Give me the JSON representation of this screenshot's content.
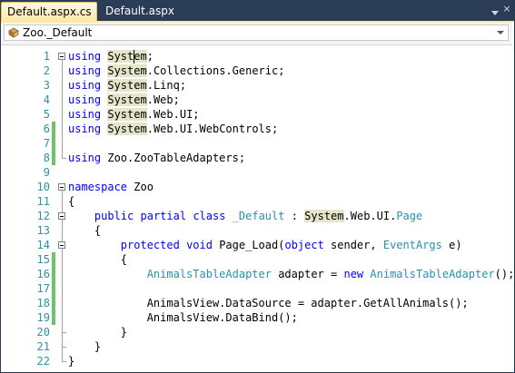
{
  "tabs": [
    {
      "label": "Default.aspx.cs",
      "active": true
    },
    {
      "label": "Default.aspx",
      "active": false
    }
  ],
  "navigation": {
    "type_dropdown": "Zoo._Default",
    "icon": "class-icon"
  },
  "close_glyph": "×",
  "colors": {
    "keyword": "#0000ff",
    "type": "#2b91af",
    "line_number": "#2b91af",
    "change_saved": "#6dc46d",
    "highlight": "#e5e5c9",
    "frame": "#293955",
    "active_tab": "#ffe8a6"
  },
  "lines": [
    {
      "n": "1",
      "change": "none",
      "tokens": [
        {
          "t": "using",
          "c": "kw"
        },
        {
          "t": " "
        },
        {
          "t": "System",
          "c": "hl"
        },
        {
          "t": ";"
        }
      ]
    },
    {
      "n": "2",
      "change": "none",
      "tokens": [
        {
          "t": "using",
          "c": "kw"
        },
        {
          "t": " "
        },
        {
          "t": "System",
          "c": "hl"
        },
        {
          "t": ".Collections.Generic;"
        }
      ]
    },
    {
      "n": "3",
      "change": "none",
      "tokens": [
        {
          "t": "using",
          "c": "kw"
        },
        {
          "t": " "
        },
        {
          "t": "System",
          "c": "hl"
        },
        {
          "t": ".Linq;"
        }
      ]
    },
    {
      "n": "4",
      "change": "none",
      "tokens": [
        {
          "t": "using",
          "c": "kw"
        },
        {
          "t": " "
        },
        {
          "t": "System",
          "c": "hl"
        },
        {
          "t": ".Web;"
        }
      ]
    },
    {
      "n": "5",
      "change": "none",
      "tokens": [
        {
          "t": "using",
          "c": "kw"
        },
        {
          "t": " "
        },
        {
          "t": "System",
          "c": "hl"
        },
        {
          "t": ".Web.UI;"
        }
      ]
    },
    {
      "n": "6",
      "change": "green",
      "tokens": [
        {
          "t": "using",
          "c": "kw"
        },
        {
          "t": " "
        },
        {
          "t": "System",
          "c": "hl"
        },
        {
          "t": ".Web.UI.WebControls;"
        }
      ]
    },
    {
      "n": "7",
      "change": "green",
      "tokens": []
    },
    {
      "n": "8",
      "change": "green",
      "tokens": [
        {
          "t": "using",
          "c": "kw"
        },
        {
          "t": " Zoo.ZooTableAdapters;"
        }
      ]
    },
    {
      "n": "9",
      "change": "none",
      "tokens": []
    },
    {
      "n": "10",
      "change": "none",
      "tokens": [
        {
          "t": "namespace",
          "c": "kw"
        },
        {
          "t": " Zoo"
        }
      ]
    },
    {
      "n": "11",
      "change": "none",
      "tokens": [
        {
          "t": "{"
        }
      ]
    },
    {
      "n": "12",
      "change": "none",
      "tokens": [
        {
          "t": "    "
        },
        {
          "t": "public",
          "c": "kw"
        },
        {
          "t": " "
        },
        {
          "t": "partial",
          "c": "kw"
        },
        {
          "t": " "
        },
        {
          "t": "class",
          "c": "kw"
        },
        {
          "t": " "
        },
        {
          "t": "_Default",
          "c": "ty"
        },
        {
          "t": " : "
        },
        {
          "t": "System",
          "c": "hl"
        },
        {
          "t": ".Web.UI."
        },
        {
          "t": "Page",
          "c": "ty"
        }
      ]
    },
    {
      "n": "13",
      "change": "none",
      "tokens": [
        {
          "t": "    {"
        }
      ]
    },
    {
      "n": "14",
      "change": "none",
      "tokens": [
        {
          "t": "        "
        },
        {
          "t": "protected",
          "c": "kw"
        },
        {
          "t": " "
        },
        {
          "t": "void",
          "c": "kw"
        },
        {
          "t": " Page_Load("
        },
        {
          "t": "object",
          "c": "kw"
        },
        {
          "t": " sender, "
        },
        {
          "t": "EventArgs",
          "c": "ty"
        },
        {
          "t": " e)"
        }
      ]
    },
    {
      "n": "15",
      "change": "green",
      "tokens": [
        {
          "t": "        {"
        }
      ]
    },
    {
      "n": "16",
      "change": "green",
      "tokens": [
        {
          "t": "            "
        },
        {
          "t": "AnimalsTableAdapter",
          "c": "ty"
        },
        {
          "t": " adapter = "
        },
        {
          "t": "new",
          "c": "kw"
        },
        {
          "t": " "
        },
        {
          "t": "AnimalsTableAdapter",
          "c": "ty"
        },
        {
          "t": "();"
        }
      ]
    },
    {
      "n": "17",
      "change": "green",
      "tokens": []
    },
    {
      "n": "18",
      "change": "green",
      "tokens": [
        {
          "t": "            AnimalsView.DataSource = adapter.GetAllAnimals();"
        }
      ]
    },
    {
      "n": "19",
      "change": "green",
      "tokens": [
        {
          "t": "            AnimalsView.DataBind();"
        }
      ]
    },
    {
      "n": "20",
      "change": "none",
      "tokens": [
        {
          "t": "        }"
        }
      ]
    },
    {
      "n": "21",
      "change": "none",
      "tokens": [
        {
          "t": "    }"
        }
      ]
    },
    {
      "n": "22",
      "change": "none",
      "tokens": [
        {
          "t": "}"
        }
      ]
    }
  ]
}
